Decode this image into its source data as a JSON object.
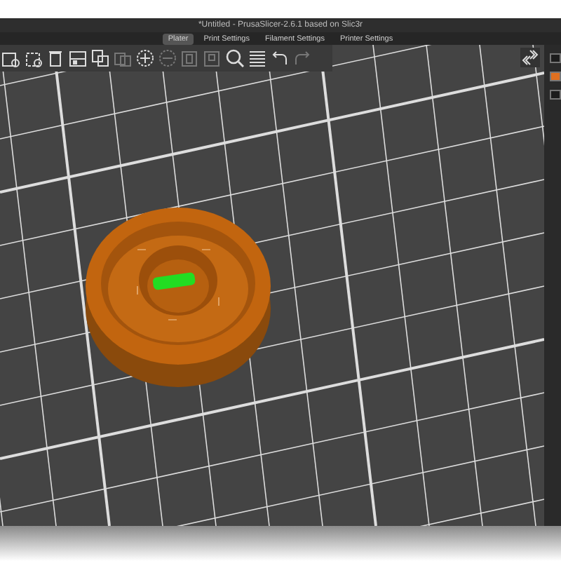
{
  "window": {
    "title": "*Untitled - PrusaSlicer-2.6.1 based on Slic3r"
  },
  "tabs": [
    {
      "label": "Plater",
      "selected": true
    },
    {
      "label": "Print Settings",
      "selected": false
    },
    {
      "label": "Filament Settings",
      "selected": false
    },
    {
      "label": "Printer Settings",
      "selected": false
    }
  ]
}
